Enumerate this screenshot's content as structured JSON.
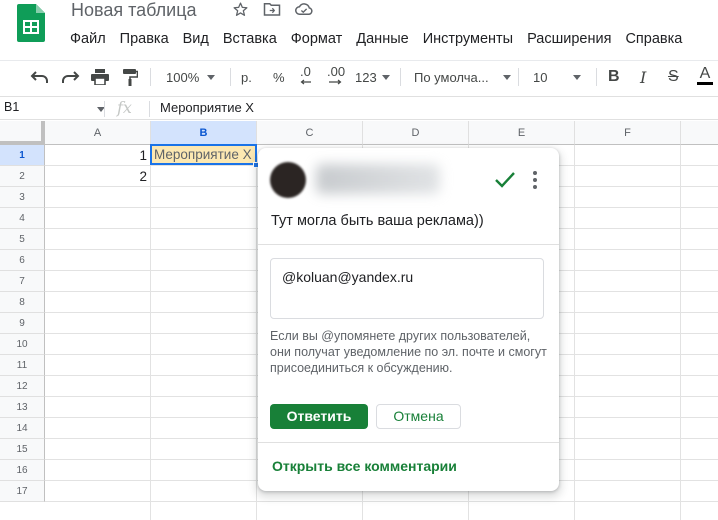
{
  "header": {
    "title": "Новая таблица",
    "icons": [
      "star-icon",
      "move-to-folder-icon",
      "cloud-status-icon"
    ]
  },
  "menu": [
    "Файл",
    "Правка",
    "Вид",
    "Вставка",
    "Формат",
    "Данные",
    "Инструменты",
    "Расширения",
    "Справка"
  ],
  "toolbar": {
    "zoom": "100%",
    "currency": "р.",
    "percent": "%",
    "decrease_decimals": ".0",
    "increase_decimals": ".00",
    "more_formats": "123",
    "font": "По умолча...",
    "font_size": "10",
    "bold": "B",
    "italic": "I",
    "strikethrough": "S",
    "text_color": "A"
  },
  "formula_bar": {
    "name_box": "B1",
    "fx": "fx",
    "content": "Мероприятие X"
  },
  "grid": {
    "columns": [
      "A",
      "B",
      "C",
      "D",
      "E",
      "F"
    ],
    "rows": [
      "1",
      "2",
      "3",
      "4",
      "5",
      "6",
      "7",
      "8",
      "9",
      "10",
      "11",
      "12",
      "13",
      "14",
      "15",
      "16",
      "17"
    ],
    "cells": {
      "A1": "1",
      "A2": "2",
      "B1": "Мероприятие X"
    },
    "selected_cell": "B1"
  },
  "comment": {
    "text": "Тут могла быть ваша реклама))",
    "reply_value": "@koluan@yandex.ru",
    "hint": "Если вы @упомянете других пользователей, они получат уведомление по эл. почте и смогут присоединиться к обсуждению.",
    "reply_button": "Ответить",
    "cancel_button": "Отмена",
    "open_all": "Открыть все комментарии"
  },
  "colors": {
    "accent_green": "#188038",
    "selection_blue": "#1a73e8",
    "cell_highlight": "#fce8b2"
  }
}
